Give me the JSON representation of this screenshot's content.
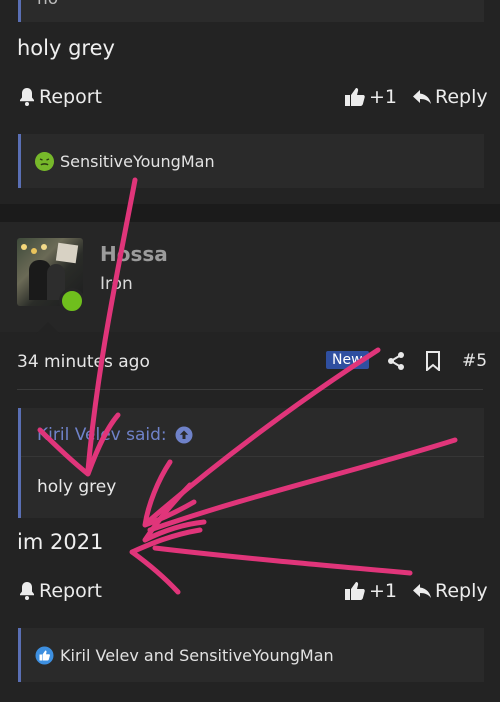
{
  "post1": {
    "quote_fragment": "no",
    "message": "holy grey",
    "report_label": "Report",
    "like_count": "+1",
    "reply_label": "Reply",
    "reactions_text": "SensitiveYoungMan"
  },
  "post2": {
    "author_name": "Hossa",
    "author_rank": "Iron",
    "timestamp": "34 minutes ago",
    "new_badge": "New",
    "post_number": "#5",
    "quote_author": "Kiril Velev said:",
    "quote_text": "holy grey",
    "message": "im 2021",
    "report_label": "Report",
    "like_count": "+1",
    "reply_label": "Reply",
    "reactions_text": "Kiril Velev and SensitiveYoungMan"
  },
  "colors": {
    "accent_blue": "#5a6fb4",
    "online_green": "#6fbf1d",
    "annotation_pink": "#e0357a",
    "new_badge": "#2f4fa0"
  },
  "icons": [
    "bell-icon",
    "thumbs-up-icon",
    "reply-arrow-icon",
    "share-icon",
    "bookmark-icon",
    "quote-up-arrow-icon",
    "sick-emoji-icon",
    "like-emoji-icon"
  ]
}
